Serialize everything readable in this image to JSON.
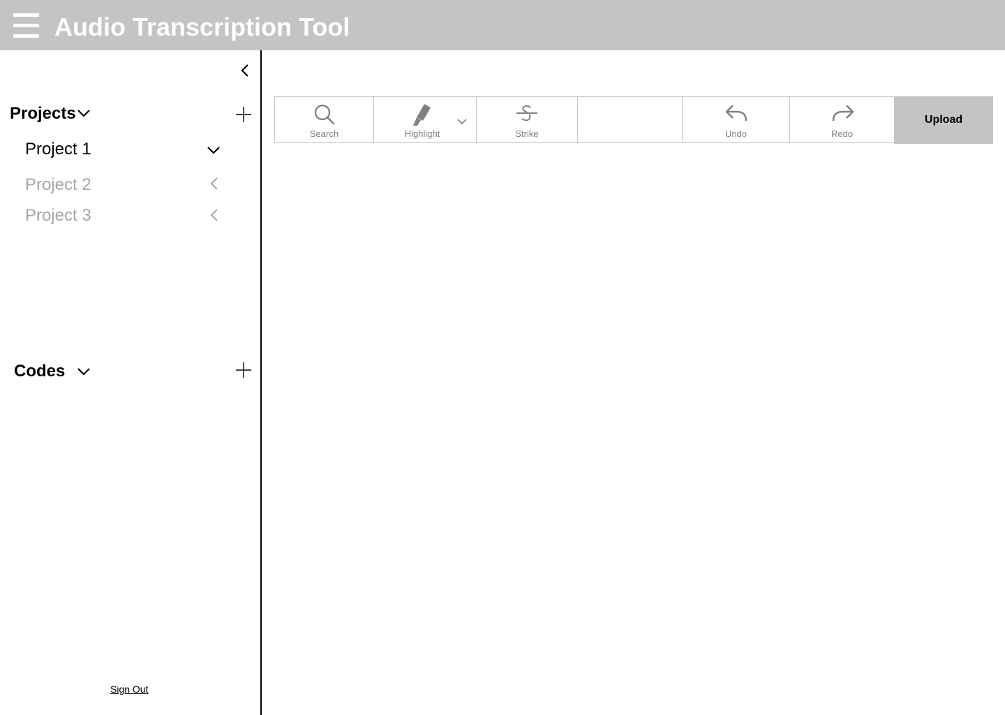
{
  "header": {
    "title": "Audio Transcription Tool",
    "menu_icon": "hamburger-menu-icon"
  },
  "sidebar": {
    "projects_title": "Projects",
    "projects": [
      {
        "label": "Project 1",
        "state": "expanded"
      },
      {
        "label": "Project 2",
        "state": "collapsed"
      },
      {
        "label": "Project 3",
        "state": "collapsed"
      }
    ],
    "codes_title": "Codes",
    "sign_out": "Sign Out"
  },
  "toolbar": {
    "search_label": "Search",
    "highlight_label": "Highlight",
    "strike_label": "Strike",
    "undo_label": "Undo",
    "redo_label": "Redo",
    "upload_label": "Upload"
  },
  "colors": {
    "header_bg": "#c4c4c4",
    "header_text": "#ffffff",
    "inactive_text": "#a6a6a6",
    "tool_label": "#808080",
    "tool_border": "#c4c4c4",
    "upload_bg": "#c4c4c4"
  }
}
